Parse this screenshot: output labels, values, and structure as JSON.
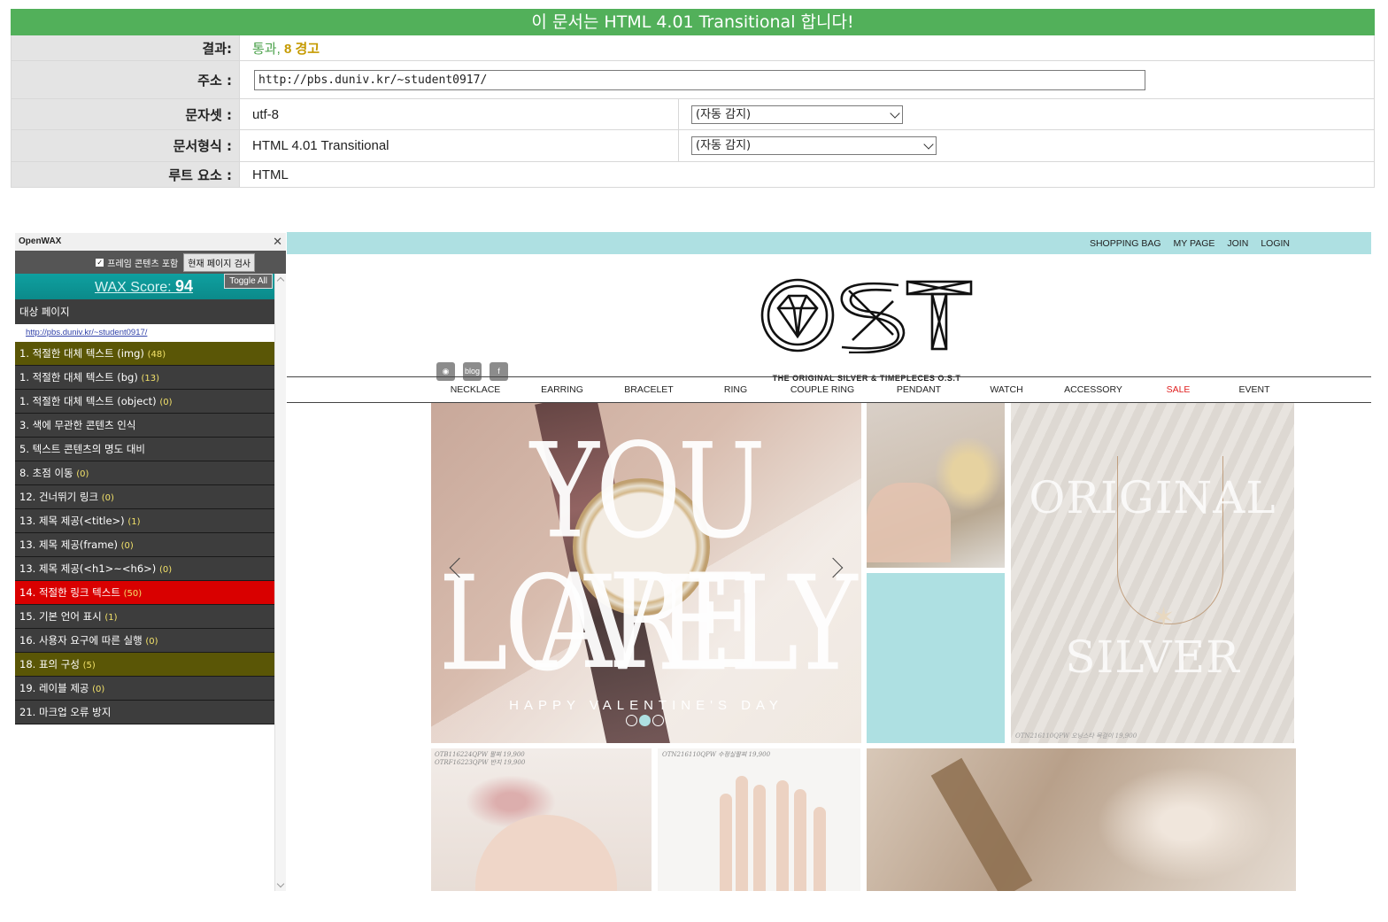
{
  "validator": {
    "banner": "이 문서는 HTML 4.01 Transitional 합니다!",
    "result_label": "결과:",
    "result_pass": "통과,",
    "result_warn": "8 경고",
    "address_label": "주소 :",
    "address_value": "http://pbs.duniv.kr/~student0917/",
    "charset_label": "문자셋 :",
    "charset_value": "utf-8",
    "charset_select": "(자동 감지)",
    "doctype_label": "문서형식 :",
    "doctype_value": "HTML 4.01 Transitional",
    "doctype_select": "(자동 감지)",
    "root_label": "루트 요소 :",
    "root_value": "HTML"
  },
  "wax": {
    "title": "OpenWAX",
    "close": "✕",
    "frame_checkbox_label": "프레임 콘텐츠 포함",
    "frame_checkbox_checked": true,
    "scan_button": "현재 페이지 검사",
    "score_label": "WAX Score:",
    "score_value": "94",
    "toggle_all": "Toggle All",
    "target_label": "대상 페이지",
    "target_url": "http://pbs.duniv.kr/~student0917/",
    "items": [
      {
        "label": "1. 적절한 대체 텍스트 (img)",
        "count": "(48)",
        "status": "warn"
      },
      {
        "label": "1. 적절한 대체 텍스트 (bg)",
        "count": "(13)",
        "status": "normal"
      },
      {
        "label": "1. 적절한 대체 텍스트 (object)",
        "count": "(0)",
        "status": "normal"
      },
      {
        "label": "3. 색에 무관한 콘텐츠 인식",
        "count": "",
        "status": "normal"
      },
      {
        "label": "5. 텍스트 콘텐츠의 명도 대비",
        "count": "",
        "status": "normal"
      },
      {
        "label": "8. 초점 이동",
        "count": "(0)",
        "status": "normal"
      },
      {
        "label": "12. 건너뛰기 링크",
        "count": "(0)",
        "status": "normal"
      },
      {
        "label": "13. 제목 제공(<title>)",
        "count": "(1)",
        "status": "normal"
      },
      {
        "label": "13. 제목 제공(frame)",
        "count": "(0)",
        "status": "normal"
      },
      {
        "label": "13. 제목 제공(<h1>~<h6>)",
        "count": "(0)",
        "status": "normal"
      },
      {
        "label": "14. 적절한 링크 텍스트",
        "count": "(50)",
        "status": "error"
      },
      {
        "label": "15. 기본 언어 표시",
        "count": "(1)",
        "status": "normal"
      },
      {
        "label": "16. 사용자 요구에 따른 실행",
        "count": "(0)",
        "status": "normal"
      },
      {
        "label": "18. 표의 구성",
        "count": "(5)",
        "status": "warn"
      },
      {
        "label": "19. 레이블 제공",
        "count": "(0)",
        "status": "normal"
      },
      {
        "label": "21. 마크업 오류 방지",
        "count": "",
        "status": "normal"
      }
    ]
  },
  "site": {
    "top_links": [
      "SHOPPING BAG",
      "MY PAGE",
      "JOIN",
      "LOGIN"
    ],
    "logo_text": "OST",
    "logo_tagline": "THE ORIGINAL SILVER & TIMEPLECES O.S.T",
    "social": [
      {
        "icon": "instagram-icon",
        "label": "◉"
      },
      {
        "icon": "blog-icon",
        "label": "blog"
      },
      {
        "icon": "facebook-icon",
        "label": "f"
      }
    ],
    "nav": [
      "NECKLACE",
      "EARRING",
      "BRACELET",
      "RING",
      "COUPLE RING",
      "PENDANT",
      "WATCH",
      "ACCESSORY",
      "SALE",
      "EVENT"
    ],
    "hero": {
      "line1": "YOU ARE",
      "line2": "LOVELY",
      "sub": "HAPPY VALENTINE'S DAY",
      "slide_count": 3,
      "active_slide": 2
    },
    "necklace_tile": {
      "word1": "ORIGINAL",
      "word2": "SILVER",
      "caption": "OTN216110QPW 오닝스타 목걸이 19,900"
    },
    "flower_caption_1": "OTB116224QPW 팔찌 19,900",
    "flower_caption_2": "OTRF16223QPW 반지 19,900",
    "hands_caption": "OTN216110QPW 수정실팔찌 19,900",
    "colors": {
      "banner_green": "#52b05a",
      "accent_mint": "#aee0e2",
      "sale_red": "#e02020",
      "wax_teal": "#0fa0a0",
      "wax_error": "#d90000",
      "wax_warn": "#5a5606"
    }
  }
}
